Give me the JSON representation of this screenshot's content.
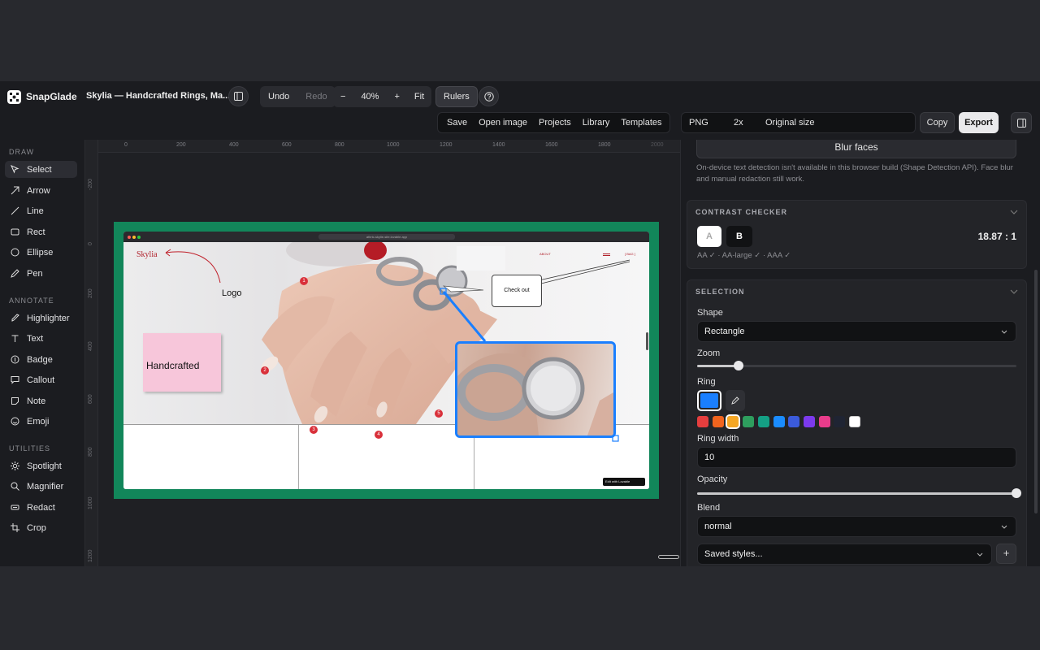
{
  "app": {
    "name": "SnapGlade",
    "doc_title": "Skylia — Handcrafted Rings, Ma..."
  },
  "toolbar": {
    "undo": "Undo",
    "redo": "Redo",
    "zoom_out": "−",
    "zoom": "40%",
    "zoom_in": "+",
    "fit": "Fit",
    "rulers": "Rulers",
    "save": "Save",
    "open_image": "Open image",
    "projects": "Projects",
    "library": "Library",
    "templates": "Templates",
    "format": "PNG",
    "scale": "2x",
    "size": "Original size",
    "copy": "Copy",
    "export": "Export"
  },
  "sidebar": {
    "draw_heading": "DRAW",
    "draw": [
      "Select",
      "Arrow",
      "Line",
      "Rect",
      "Ellipse",
      "Pen"
    ],
    "annotate_heading": "ANNOTATE",
    "annotate": [
      "Highlighter",
      "Text",
      "Badge",
      "Callout",
      "Note",
      "Emoji"
    ],
    "utilities_heading": "UTILITIES",
    "utilities": [
      "Spotlight",
      "Magnifier",
      "Redact",
      "Crop"
    ]
  },
  "ruler": {
    "h": [
      "0",
      "200",
      "400",
      "600",
      "800",
      "1000",
      "1200",
      "1400",
      "1600",
      "1800",
      "2000"
    ],
    "v": [
      "-200",
      "0",
      "200",
      "400",
      "600",
      "800",
      "1000",
      "1200"
    ]
  },
  "canvas": {
    "url": "athric-skylie-site.lovable.app",
    "site_logo": "Skylia",
    "nav_about": "ABOUT",
    "nav_bag": "[ BAG ]",
    "logo_label": "Logo",
    "note_text": "Handcrafted",
    "callout_text": "Check out",
    "badges": [
      "1",
      "2",
      "3",
      "4",
      "5"
    ],
    "edit_badge": "Edit with Lovable"
  },
  "panel": {
    "blur_faces": "Blur faces",
    "detect_note": "On-device text detection isn't available in this browser build (Shape Detection API). Face blur and manual redaction still work.",
    "contrast_title": "CONTRAST CHECKER",
    "contrast_a": "A",
    "contrast_b": "B",
    "contrast_ratio": "18.87 : 1",
    "contrast_result": "AA ✓ · AA-large ✓ · AAA ✓",
    "selection_title": "SELECTION",
    "shape_label": "Shape",
    "shape_value": "Rectangle",
    "zoom_label": "Zoom",
    "zoom_level": 0.13,
    "ring_label": "Ring",
    "ring_color": "#1a7fff",
    "swatches": [
      "#e53e3e",
      "#f0641e",
      "#f5a623",
      "#2e9e5e",
      "#14a085",
      "#1a8cff",
      "#3b5bdb",
      "#7c3aed",
      "#e93c8b",
      "#1f2433",
      "#ffffff"
    ],
    "ring_width_label": "Ring width",
    "ring_width": "10",
    "opacity_label": "Opacity",
    "opacity": 1.0,
    "blend_label": "Blend",
    "blend_value": "normal",
    "saved_styles": "Saved styles...",
    "add": "+"
  }
}
